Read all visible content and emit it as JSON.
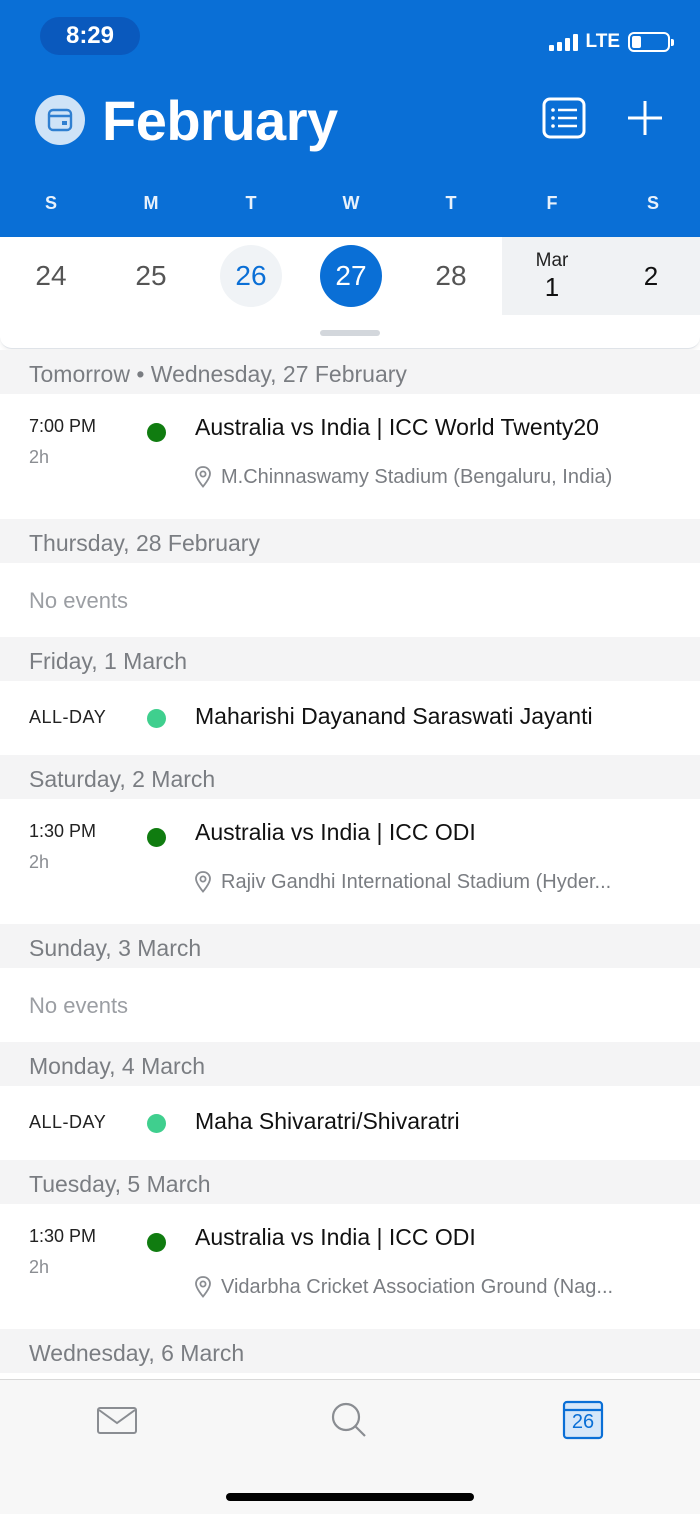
{
  "status_bar": {
    "time": "8:29",
    "network": "LTE"
  },
  "header": {
    "month": "February",
    "weekdays": [
      "S",
      "M",
      "T",
      "W",
      "T",
      "F",
      "S"
    ]
  },
  "date_strip": {
    "dates": [
      "24",
      "25",
      "26",
      "27",
      "28",
      "1",
      "2"
    ],
    "next_month_label": "Mar",
    "today": "26",
    "selected": "27"
  },
  "agenda": [
    {
      "day": "Tomorrow • Wednesday, 27 February",
      "events": [
        {
          "time": "7:00 PM",
          "duration": "2h",
          "title": "Australia vs India | ICC World Twenty20",
          "location": "M.Chinnaswamy Stadium (Bengaluru, India)",
          "dot_color": "#107c10"
        }
      ]
    },
    {
      "day": "Thursday, 28 February",
      "no_events": "No events"
    },
    {
      "day": "Friday, 1 March",
      "events": [
        {
          "time": "ALL-DAY",
          "title": "Maharishi Dayanand Saraswati Jayanti",
          "dot_color": "#3fcf8e"
        }
      ]
    },
    {
      "day": "Saturday, 2 March",
      "events": [
        {
          "time": "1:30 PM",
          "duration": "2h",
          "title": "Australia vs India | ICC ODI",
          "location": "Rajiv Gandhi International Stadium (Hyder...",
          "dot_color": "#107c10"
        }
      ]
    },
    {
      "day": "Sunday, 3 March",
      "no_events": "No events"
    },
    {
      "day": "Monday, 4 March",
      "events": [
        {
          "time": "ALL-DAY",
          "title": "Maha Shivaratri/Shivaratri",
          "dot_color": "#3fcf8e"
        }
      ]
    },
    {
      "day": "Tuesday, 5 March",
      "events": [
        {
          "time": "1:30 PM",
          "duration": "2h",
          "title": "Australia vs India | ICC ODI",
          "location": "Vidarbha Cricket Association Ground (Nag...",
          "dot_color": "#107c10"
        }
      ]
    },
    {
      "day": "Wednesday, 6 March"
    }
  ],
  "tabbar": {
    "calendar_icon_day": "26",
    "icons": [
      "mail-icon",
      "search-icon",
      "calendar-icon"
    ],
    "active_color": "#0a6fd6"
  },
  "colors": {
    "brand": "#0a6fd6",
    "event_green": "#107c10",
    "holiday_green": "#3fcf8e"
  }
}
